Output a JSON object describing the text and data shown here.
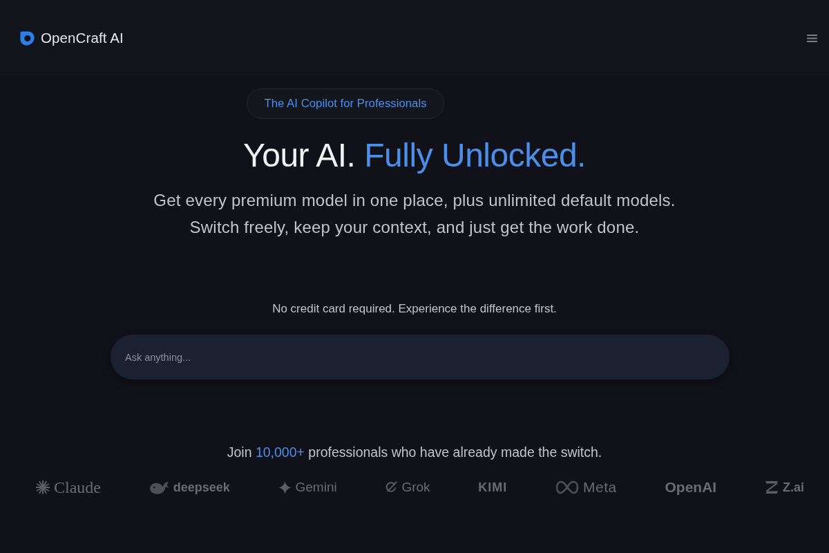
{
  "header": {
    "brand": "OpenCraft AI"
  },
  "hero": {
    "badge": "The AI Copilot for Professionals",
    "heading": {
      "text": "Your AI.",
      "highlight": "Fully Unlocked."
    },
    "subtitle_lines": [
      "Get every premium model in one place, plus unlimited default models.",
      "Switch freely, keep your context, and just get the work done."
    ],
    "note": "No credit card required. Experience the difference first.",
    "prompt": {
      "placeholder": "Ask anything..."
    }
  },
  "social_proof": {
    "text_before": "Join",
    "highlight": "10,000+",
    "text_after": "professionals who have already made the switch.",
    "logos": [
      "Claude",
      "deepseek",
      "Gemini",
      "Grok",
      "KIMI",
      "Meta",
      "OpenAI",
      "Z.ai"
    ]
  }
}
